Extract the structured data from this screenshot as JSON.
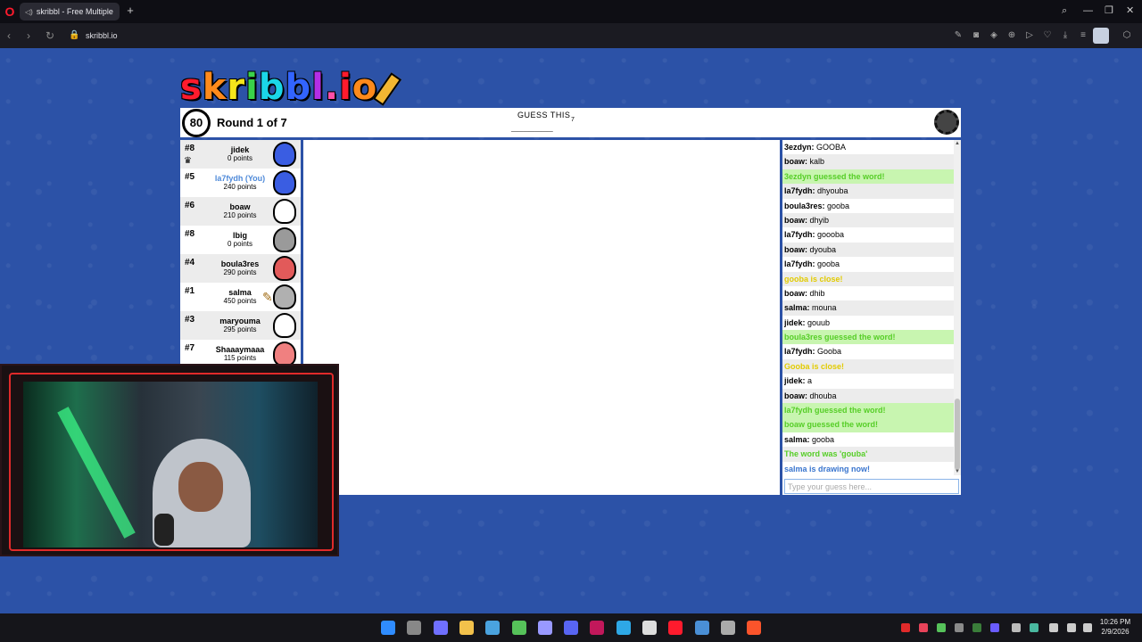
{
  "browser": {
    "tab_title": "skribbl - Free Multiple",
    "url": "skribbl.io",
    "new_tab": "+"
  },
  "game": {
    "logo_letters": [
      "s",
      "k",
      "r",
      "i",
      "b",
      "b",
      "l",
      ".",
      "i",
      "o"
    ],
    "logo_colors": [
      "#ff1b2d",
      "#ff8a1b",
      "#f5e51b",
      "#3ad24a",
      "#1bd6e8",
      "#3264ff",
      "#b52ee6",
      "#ff4fa7",
      "#ff1b2d",
      "#ff8a1b"
    ],
    "timer": "80",
    "round": "Round 1 of 7",
    "guess_label": "GUESS THIS",
    "word_blanks": "_______",
    "word_length": "7"
  },
  "players": [
    {
      "rank": "#8",
      "name": "jidek",
      "points": "0 points",
      "avatar_color": "#3a5de2",
      "you": false,
      "owner": true,
      "drawing": false
    },
    {
      "rank": "#5",
      "name": "la7fydh (You)",
      "points": "240 points",
      "avatar_color": "#3a5de2",
      "you": true,
      "owner": false,
      "drawing": false
    },
    {
      "rank": "#6",
      "name": "boaw",
      "points": "210 points",
      "avatar_color": "#ffffff",
      "you": false,
      "owner": false,
      "drawing": false
    },
    {
      "rank": "#8",
      "name": "lbig",
      "points": "0 points",
      "avatar_color": "#9a9a9a",
      "you": false,
      "owner": false,
      "drawing": false
    },
    {
      "rank": "#4",
      "name": "boula3res",
      "points": "290 points",
      "avatar_color": "#e25a5a",
      "you": false,
      "owner": false,
      "drawing": false
    },
    {
      "rank": "#1",
      "name": "salma",
      "points": "450 points",
      "avatar_color": "#b0b0b0",
      "you": false,
      "owner": false,
      "drawing": true
    },
    {
      "rank": "#3",
      "name": "maryouma",
      "points": "295 points",
      "avatar_color": "#ffffff",
      "you": false,
      "owner": false,
      "drawing": false
    },
    {
      "rank": "#7",
      "name": "Shaaaymaaa",
      "points": "115 points",
      "avatar_color": "#f08080",
      "you": false,
      "owner": false,
      "drawing": false
    }
  ],
  "chat": {
    "messages": [
      {
        "author": "3ezdyn",
        "text": "GOOBA",
        "style": "normal"
      },
      {
        "author": "boaw",
        "text": "kalb",
        "style": "normal"
      },
      {
        "author": "",
        "text": "3ezdyn guessed the word!",
        "style": "green"
      },
      {
        "author": "la7fydh",
        "text": "dhyouba",
        "style": "normal"
      },
      {
        "author": "boula3res",
        "text": "gooba",
        "style": "normal"
      },
      {
        "author": "boaw",
        "text": "dhyib",
        "style": "normal"
      },
      {
        "author": "la7fydh",
        "text": "goooba",
        "style": "normal"
      },
      {
        "author": "boaw",
        "text": "dyouba",
        "style": "normal"
      },
      {
        "author": "la7fydh",
        "text": "gooba",
        "style": "normal"
      },
      {
        "author": "",
        "text": "gooba is close!",
        "style": "yellow"
      },
      {
        "author": "boaw",
        "text": "dhib",
        "style": "normal"
      },
      {
        "author": "salma",
        "text": "mouna",
        "style": "normal"
      },
      {
        "author": "jidek",
        "text": "gouub",
        "style": "normal"
      },
      {
        "author": "",
        "text": "boula3res guessed the word!",
        "style": "green"
      },
      {
        "author": "la7fydh",
        "text": "Gooba",
        "style": "normal"
      },
      {
        "author": "",
        "text": "Gooba is close!",
        "style": "yellow"
      },
      {
        "author": "jidek",
        "text": "a",
        "style": "normal"
      },
      {
        "author": "boaw",
        "text": "dhouba",
        "style": "normal"
      },
      {
        "author": "",
        "text": "la7fydh guessed the word!",
        "style": "green"
      },
      {
        "author": "",
        "text": "boaw guessed the word!",
        "style": "green"
      },
      {
        "author": "salma",
        "text": "gooba",
        "style": "normal"
      },
      {
        "author": "",
        "text": "The word was 'gouba'",
        "style": "greenplain"
      },
      {
        "author": "",
        "text": "salma is drawing now!",
        "style": "blue"
      }
    ],
    "input_placeholder": "Type your guess here..."
  },
  "taskbar": {
    "time": "10:26 PM",
    "date": "2/9/2026",
    "app_colors": [
      "#2f8cff",
      "#888888",
      "#6f6fff",
      "#f2c14b",
      "#4aa3df",
      "#56c25a",
      "#9999ff",
      "#5865f2",
      "#c2185b",
      "#2ea8e6",
      "#dddddd",
      "#ff1b2d",
      "#4a8fd6",
      "#aaaaaa",
      "#fb542b"
    ]
  }
}
